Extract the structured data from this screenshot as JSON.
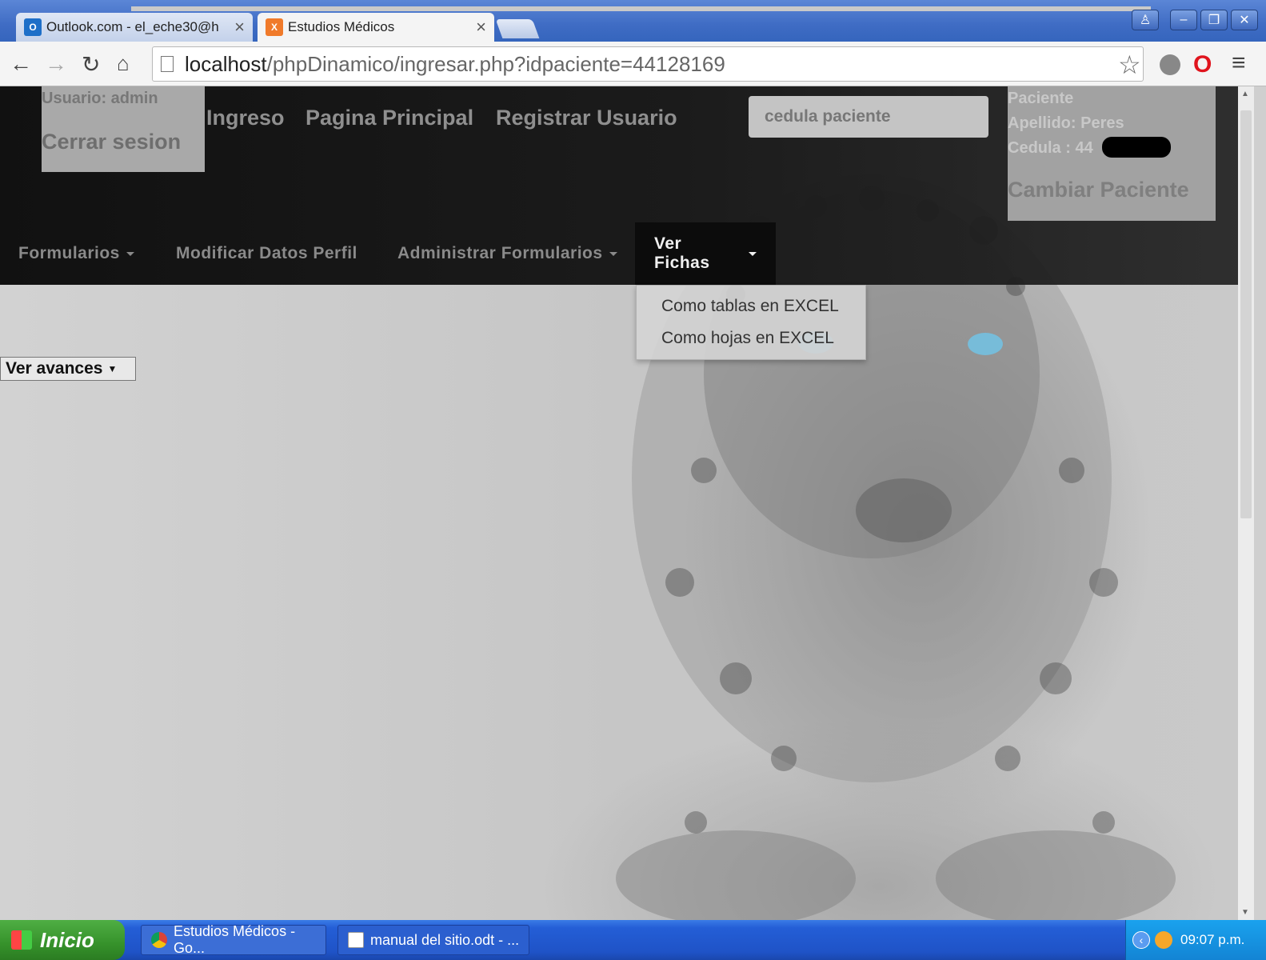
{
  "browser": {
    "tabs": [
      {
        "title": "Outlook.com - el_eche30@h",
        "icon": "outlook-icon",
        "active": false
      },
      {
        "title": "Estudios Médicos",
        "icon": "xampp-icon",
        "active": true
      }
    ],
    "url_host": "localhost",
    "url_path": "/phpDinamico/ingresar.php?idpaciente=44128169"
  },
  "header": {
    "user_label": "Usuario: admin",
    "logout_label": "Cerrar sesion",
    "links": [
      "Ingreso",
      "Pagina Principal",
      "Registrar Usuario"
    ],
    "search_placeholder": "cedula paciente",
    "patient": {
      "title": "Paciente",
      "apellido": "Apellido: Peres",
      "cedula": "Cedula : 44",
      "change_label": "Cambiar Paciente"
    }
  },
  "navbar": {
    "items": [
      {
        "label": "Formularios"
      },
      {
        "label": "Modificar Datos Perfil"
      },
      {
        "label": "Administrar Formularios"
      },
      {
        "label": "Ver Fichas"
      }
    ],
    "dropdown": [
      "Como tablas en EXCEL",
      "Como hojas en EXCEL"
    ]
  },
  "main": {
    "avances_label": "Ver avances"
  },
  "taskbar": {
    "start_label": "Inicio",
    "tasks": [
      "Estudios Médicos - Go...",
      "manual del sitio.odt - ..."
    ],
    "clock": "09:07 p.m."
  },
  "colors": {
    "header_bg": "#111111",
    "taskbar_blue": "#245ed6",
    "start_green": "#36922b"
  }
}
